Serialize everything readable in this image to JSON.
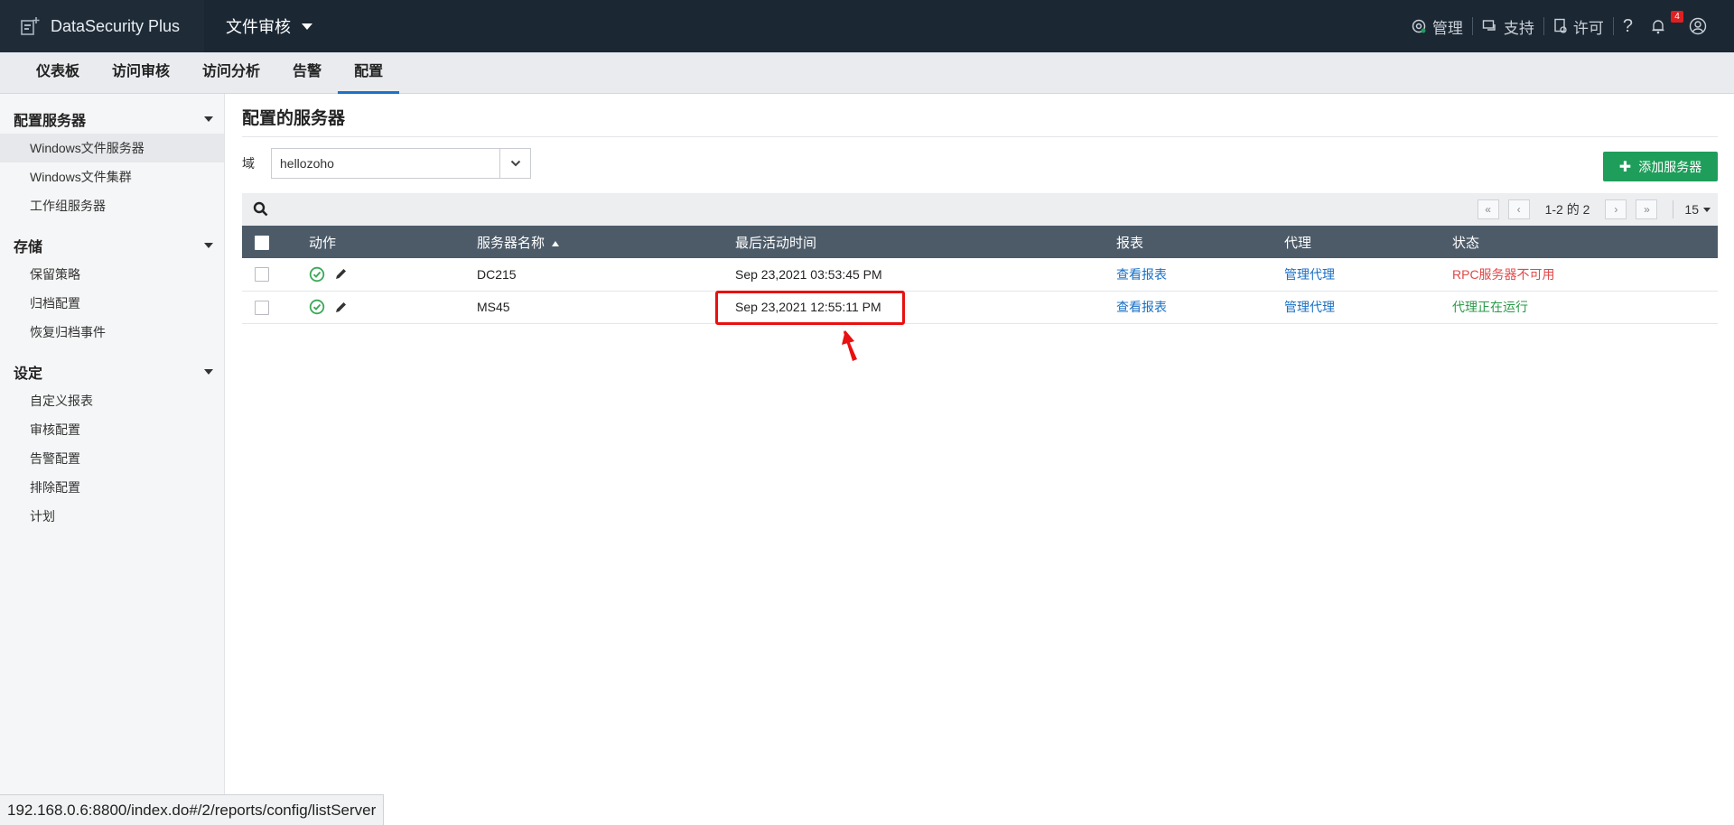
{
  "header": {
    "brand": "DataSecurity Plus",
    "module": "文件审核",
    "right_items": [
      {
        "label": "管理",
        "icon": "gear-icon"
      },
      {
        "label": "支持",
        "icon": "chat-icon"
      },
      {
        "label": "许可",
        "icon": "license-icon"
      }
    ],
    "notification_count": "4"
  },
  "nav": {
    "tabs": [
      "仪表板",
      "访问审核",
      "访问分析",
      "告警",
      "配置"
    ],
    "active": "配置"
  },
  "sidebar": {
    "groups": [
      {
        "title": "配置服务器",
        "items": [
          "Windows文件服务器",
          "Windows文件集群",
          "工作组服务器"
        ]
      },
      {
        "title": "存储",
        "items": [
          "保留策略",
          "归档配置",
          "恢复归档事件"
        ]
      },
      {
        "title": "设定",
        "items": [
          "自定义报表",
          "审核配置",
          "告警配置",
          "排除配置",
          "计划"
        ]
      }
    ],
    "active_item": "Windows文件服务器"
  },
  "main": {
    "title": "配置的服务器",
    "domain_label": "域",
    "domain_value": "hellozoho",
    "add_button": "添加服务器",
    "pager_info": "1-2 的 2",
    "page_size": "15",
    "columns": [
      "动作",
      "服务器名称",
      "最后活动时间",
      "报表",
      "代理",
      "状态"
    ],
    "rows": [
      {
        "server": "DC215",
        "last_activity": "Sep 23,2021 03:53:45 PM",
        "report": "查看报表",
        "agent": "管理代理",
        "status": "RPC服务器不可用",
        "status_color": "#e04848"
      },
      {
        "server": "MS45",
        "last_activity": "Sep 23,2021 12:55:11 PM",
        "report": "查看报表",
        "agent": "管理代理",
        "status": "代理正在运行",
        "status_color": "#2a9a48"
      }
    ]
  },
  "status_url": "192.168.0.6:8800/index.do#/2/reports/config/listServer"
}
